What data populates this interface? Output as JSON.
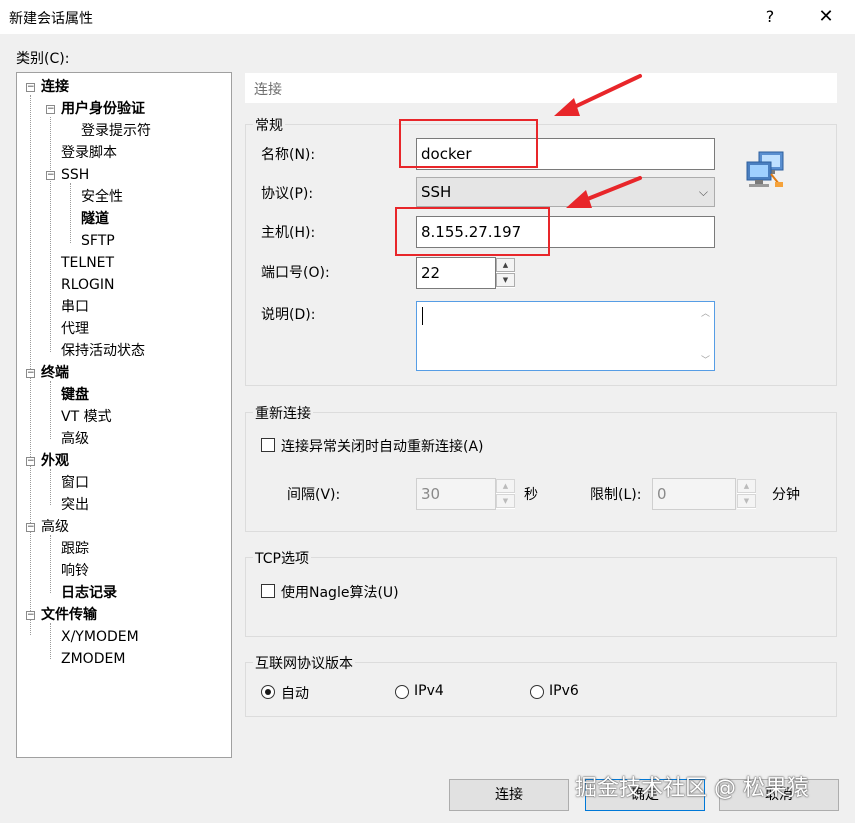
{
  "window": {
    "title": "新建会话属性",
    "help": "?",
    "close": "✕"
  },
  "category_label": "类别(C):",
  "tree": {
    "items": [
      {
        "label": "连接",
        "bold": true
      },
      {
        "label": "用户身份验证",
        "bold": true
      },
      {
        "label": "登录提示符",
        "bold": false
      },
      {
        "label": "登录脚本",
        "bold": false
      },
      {
        "label": "SSH",
        "bold": false
      },
      {
        "label": "安全性",
        "bold": false
      },
      {
        "label": "隧道",
        "bold": true
      },
      {
        "label": "SFTP",
        "bold": false
      },
      {
        "label": "TELNET",
        "bold": false
      },
      {
        "label": "RLOGIN",
        "bold": false
      },
      {
        "label": "串口",
        "bold": false
      },
      {
        "label": "代理",
        "bold": false
      },
      {
        "label": "保持活动状态",
        "bold": false
      },
      {
        "label": "终端",
        "bold": true
      },
      {
        "label": "键盘",
        "bold": true
      },
      {
        "label": "VT 模式",
        "bold": false
      },
      {
        "label": "高级",
        "bold": false
      },
      {
        "label": "外观",
        "bold": true
      },
      {
        "label": "窗口",
        "bold": false
      },
      {
        "label": "突出",
        "bold": false
      },
      {
        "label": "高级",
        "bold": false
      },
      {
        "label": "跟踪",
        "bold": false
      },
      {
        "label": "响铃",
        "bold": false
      },
      {
        "label": "日志记录",
        "bold": true
      },
      {
        "label": "文件传输",
        "bold": true
      },
      {
        "label": "X/YMODEM",
        "bold": false
      },
      {
        "label": "ZMODEM",
        "bold": false
      }
    ],
    "expander_symbol": "−"
  },
  "panel": {
    "header": "连接",
    "general": {
      "title": "常规",
      "name_label": "名称(N):",
      "name_value": "docker",
      "protocol_label": "协议(P):",
      "protocol_value": "SSH",
      "host_label": "主机(H):",
      "host_value": "8.155.27.197",
      "port_label": "端口号(O):",
      "port_value": "22",
      "desc_label": "说明(D):",
      "desc_value": ""
    },
    "reconnect": {
      "title": "重新连接",
      "checkbox_label": "连接异常关闭时自动重新连接(A)",
      "checked": false,
      "interval_label": "间隔(V):",
      "interval_value": "30",
      "interval_unit": "秒",
      "limit_label": "限制(L):",
      "limit_value": "0",
      "limit_unit": "分钟"
    },
    "tcp": {
      "title": "TCP选项",
      "nagle_label": "使用Nagle算法(U)",
      "checked": false
    },
    "ip_version": {
      "title": "互联网协议版本",
      "options": [
        "自动",
        "IPv4",
        "IPv6"
      ],
      "selected": "自动"
    }
  },
  "buttons": {
    "connect": "连接",
    "ok": "确定",
    "cancel": "取消"
  },
  "watermark": "掘金技术社区 @ 松果猿",
  "accent_colors": {
    "annotation_red": "#e8262a",
    "focus_blue": "#0078d7"
  },
  "icons": {
    "up": "▲",
    "down": "▼",
    "chevron": "⌵",
    "scroll_up": "︿",
    "scroll_down": "﹀"
  }
}
